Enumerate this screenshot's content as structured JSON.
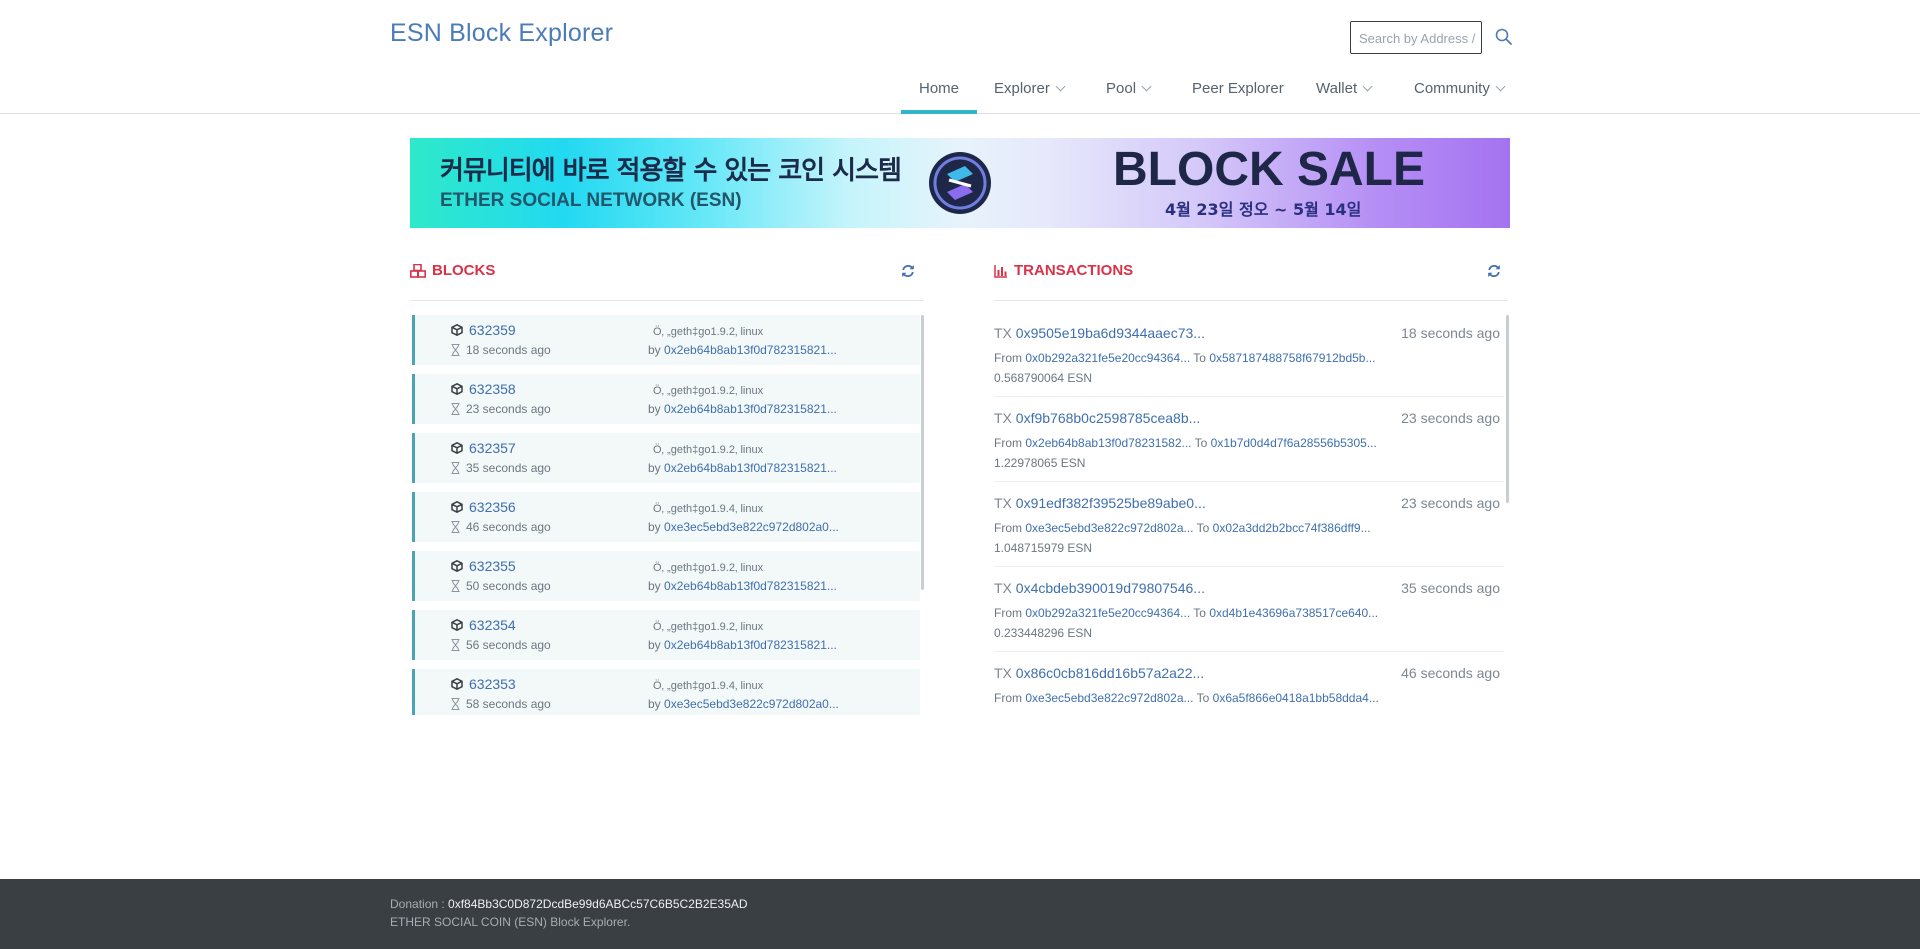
{
  "header": {
    "brand": "ESN Block Explorer",
    "search": {
      "placeholder": "Search by Address / TxHash / BlockNum"
    }
  },
  "nav": {
    "items": [
      {
        "label": "Home",
        "active": true,
        "dropdown": false
      },
      {
        "label": "Explorer",
        "active": false,
        "dropdown": true
      },
      {
        "label": "Pool",
        "active": false,
        "dropdown": true
      },
      {
        "label": "Peer Explorer",
        "active": false,
        "dropdown": false
      },
      {
        "label": "Wallet",
        "active": false,
        "dropdown": true
      },
      {
        "label": "Community",
        "active": false,
        "dropdown": true
      }
    ]
  },
  "banner": {
    "korean_title": "커뮤니티에 바로 적용할 수 있는 코인 시스템",
    "subtitle": "ETHER SOCIAL NETWORK (ESN)",
    "sale_title": "BLOCK SALE",
    "sale_dates": "4월 23일 정오 ~ 5월 14일"
  },
  "blocks_panel": {
    "title": "BLOCKS",
    "rows": [
      {
        "number": "632359",
        "age": "18 seconds ago",
        "extra": "Ö‚ „geth‡go1.9.2‚ linux",
        "by_label": "by",
        "miner": "0x2eb64b8ab13f0d782315821..."
      },
      {
        "number": "632358",
        "age": "23 seconds ago",
        "extra": "Ö‚ „geth‡go1.9.2‚ linux",
        "by_label": "by",
        "miner": "0x2eb64b8ab13f0d782315821..."
      },
      {
        "number": "632357",
        "age": "35 seconds ago",
        "extra": "Ö‚ „geth‡go1.9.2‚ linux",
        "by_label": "by",
        "miner": "0x2eb64b8ab13f0d782315821..."
      },
      {
        "number": "632356",
        "age": "46 seconds ago",
        "extra": "Ö‚ „geth‡go1.9.4‚ linux",
        "by_label": "by",
        "miner": "0xe3ec5ebd3e822c972d802a0..."
      },
      {
        "number": "632355",
        "age": "50 seconds ago",
        "extra": "Ö‚ „geth‡go1.9.2‚ linux",
        "by_label": "by",
        "miner": "0x2eb64b8ab13f0d782315821..."
      },
      {
        "number": "632354",
        "age": "56 seconds ago",
        "extra": "Ö‚ „geth‡go1.9.2‚ linux",
        "by_label": "by",
        "miner": "0x2eb64b8ab13f0d782315821..."
      },
      {
        "number": "632353",
        "age": "58 seconds ago",
        "extra": "Ö‚ „geth‡go1.9.4‚ linux",
        "by_label": "by",
        "miner": "0xe3ec5ebd3e822c972d802a0..."
      }
    ]
  },
  "transactions_panel": {
    "title": "TRANSACTIONS",
    "items": [
      {
        "tx_label": "TX",
        "hash": "0x9505e19ba6d9344aaec73...",
        "time": "18 seconds ago",
        "from_label": "From",
        "from": "0x0b292a321fe5e20cc94364...",
        "to_label": "To",
        "to": "0x587187488758f67912bd5b...",
        "amount": "0.568790064 ESN"
      },
      {
        "tx_label": "TX",
        "hash": "0xf9b768b0c2598785cea8b...",
        "time": "23 seconds ago",
        "from_label": "From",
        "from": "0x2eb64b8ab13f0d78231582...",
        "to_label": "To",
        "to": "0x1b7d0d4d7f6a28556b5305...",
        "amount": "1.22978065 ESN"
      },
      {
        "tx_label": "TX",
        "hash": "0x91edf382f39525be89abe0...",
        "time": "23 seconds ago",
        "from_label": "From",
        "from": "0xe3ec5ebd3e822c972d802a...",
        "to_label": "To",
        "to": "0x02a3dd2b2bcc74f386dff9...",
        "amount": "1.048715979 ESN"
      },
      {
        "tx_label": "TX",
        "hash": "0x4cbdeb390019d79807546...",
        "time": "35 seconds ago",
        "from_label": "From",
        "from": "0x0b292a321fe5e20cc94364...",
        "to_label": "To",
        "to": "0xd4b1e43696a738517ce640...",
        "amount": "0.233448296 ESN"
      },
      {
        "tx_label": "TX",
        "hash": "0x86c0cb816dd16b57a2a22...",
        "time": "46 seconds ago",
        "from_label": "From",
        "from": "0xe3ec5ebd3e822c972d802a...",
        "to_label": "To",
        "to": "0x6a5f866e0418a1bb58dda4...",
        "amount": ""
      }
    ]
  },
  "footer": {
    "donation_label": "Donation :",
    "donation_address": "0xf84Bb3C0D872DcdBe99d6ABCc57C6B5C2B2E35AD",
    "tagline": "ETHER SOCIAL COIN (ESN) Block Explorer."
  },
  "colors": {
    "accent_red": "#d8334a",
    "link_blue": "#3f6fae",
    "nav_underline": "#2fb6c7",
    "footer_bg": "#3a3f44"
  },
  "icons": [
    "search-icon",
    "chevron-down-icon",
    "cubes-icon",
    "bar-chart-icon",
    "refresh-icon",
    "cube-icon",
    "hourglass-icon",
    "esn-logo"
  ]
}
